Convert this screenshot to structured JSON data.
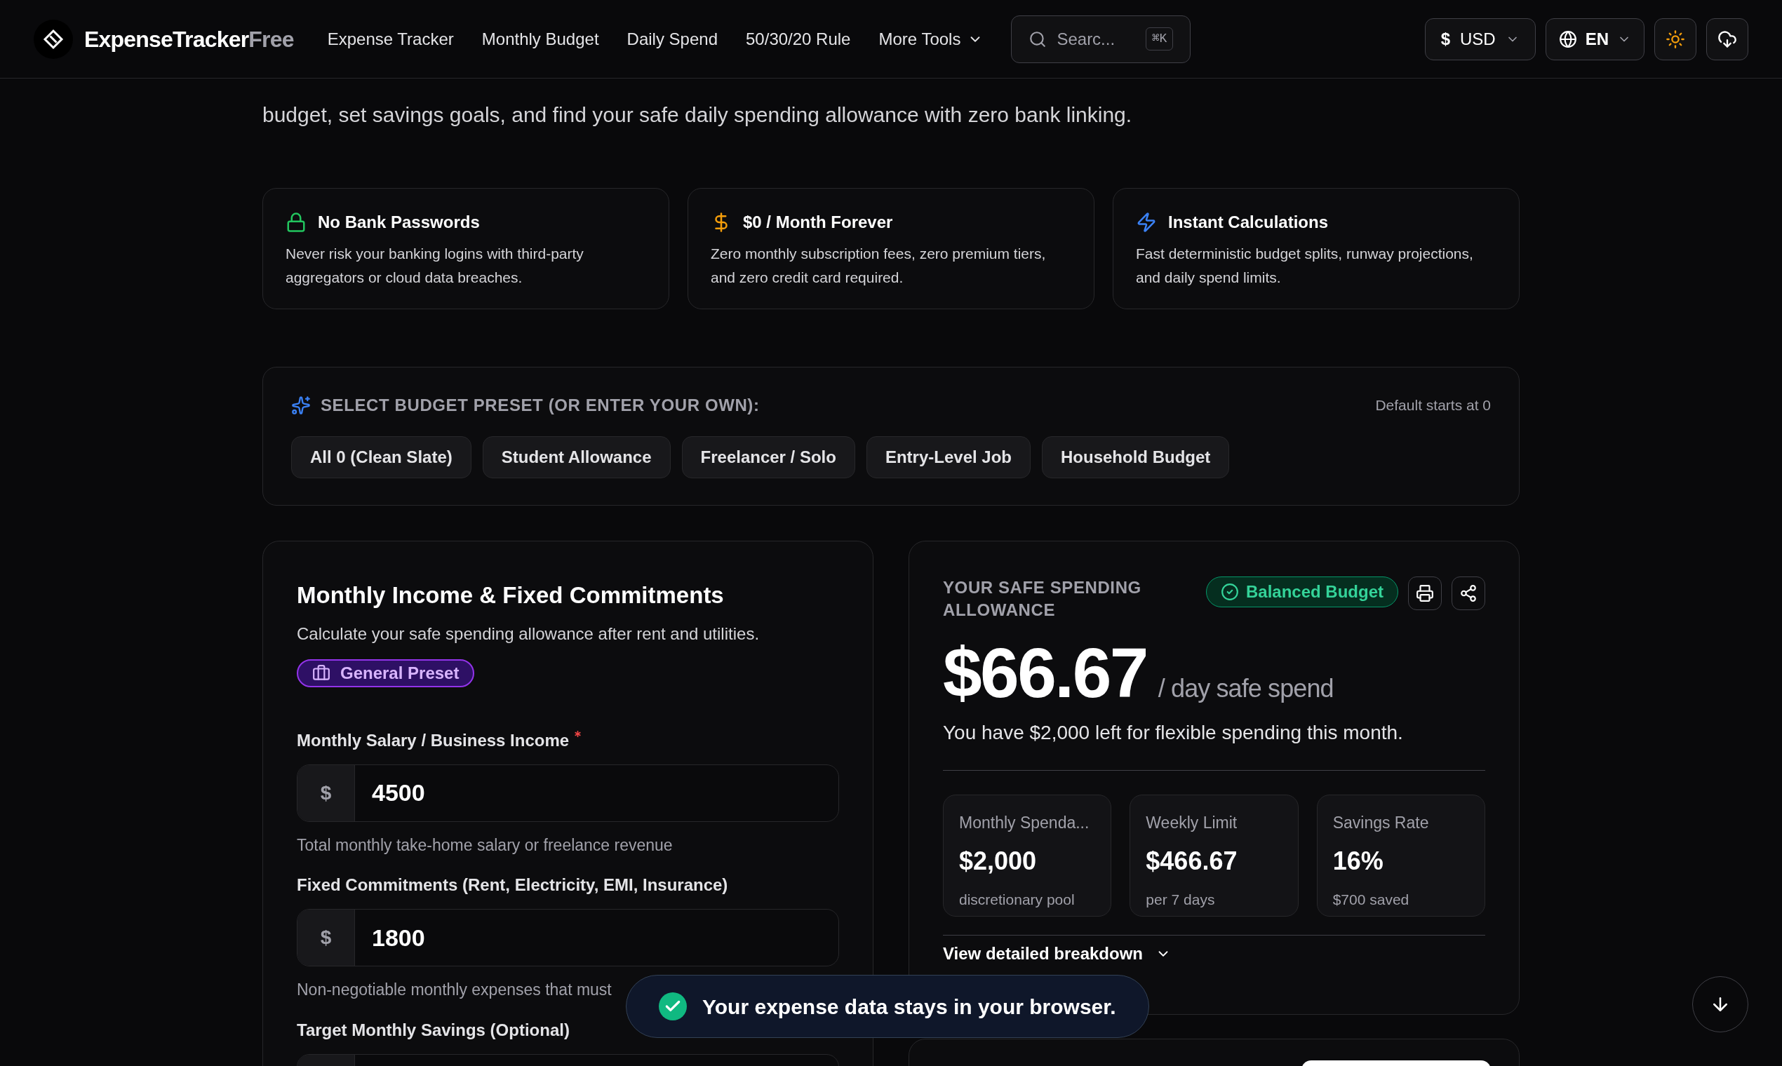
{
  "header": {
    "brand": {
      "main": "ExpenseTracker",
      "accent": "Free"
    },
    "nav": [
      {
        "label": "Expense Tracker",
        "kind": "link"
      },
      {
        "label": "Monthly Budget",
        "kind": "link"
      },
      {
        "label": "Daily Spend",
        "kind": "link"
      },
      {
        "label": "50/30/20 Rule",
        "kind": "link"
      },
      {
        "label": "More Tools",
        "kind": "dropdown"
      }
    ],
    "search": {
      "placeholder": "Searc...",
      "shortcut": "⌘K"
    },
    "currency": {
      "symbol": "$",
      "label": "USD"
    },
    "language": "EN"
  },
  "intro": "budget, set savings goals, and find your safe daily spending allowance with zero bank linking.",
  "features": [
    {
      "kind": "lock",
      "title": "No Bank Passwords",
      "description": "Never risk your banking logins with third-party aggregators or cloud data breaches."
    },
    {
      "kind": "dollar",
      "title": "$0 / Month Forever",
      "description": "Zero monthly subscription fees, zero premium tiers, and zero credit card required."
    },
    {
      "kind": "bolt",
      "title": "Instant Calculations",
      "description": "Fast deterministic budget splits, runway projections, and daily spend limits."
    }
  ],
  "presets": {
    "title": "SELECT BUDGET PRESET (OR ENTER YOUR OWN):",
    "note": "Default starts at 0",
    "options": [
      "All 0 (Clean Slate)",
      "Student Allowance",
      "Freelancer / Solo",
      "Entry-Level Job",
      "Household Budget"
    ]
  },
  "income_card": {
    "title": "Monthly Income & Fixed Commitments",
    "subtitle": "Calculate your safe spending allowance after rent and utilities.",
    "badge": "General Preset",
    "fields": [
      {
        "label": "Monthly Salary / Business Income",
        "required": true,
        "prefix": "$",
        "value": "4500",
        "hint": "Total monthly take-home salary or freelance revenue"
      },
      {
        "label": "Fixed Commitments (Rent, Electricity, EMI, Insurance)",
        "required": false,
        "prefix": "$",
        "value": "1800",
        "hint": "Non-negotiable monthly expenses that must"
      },
      {
        "label": "Target Monthly Savings (Optional)",
        "required": false
      }
    ]
  },
  "summary": {
    "heading": "YOUR SAFE SPENDING ALLOWANCE",
    "status": "Balanced Budget",
    "amount": "$66.67",
    "unit": "/ day safe spend",
    "message": "You have $2,000 left for flexible spending this month.",
    "stats": [
      {
        "label": "Monthly Spenda...",
        "value": "$2,000",
        "sub": "discretionary pool"
      },
      {
        "label": "Weekly Limit",
        "value": "$466.67",
        "sub": "per 7 days"
      },
      {
        "label": "Savings Rate",
        "value": "16%",
        "sub": "$700 saved"
      }
    ],
    "breakdown_link": "View detailed breakdown"
  },
  "toast": {
    "message": "Your expense data stays in your browser."
  }
}
